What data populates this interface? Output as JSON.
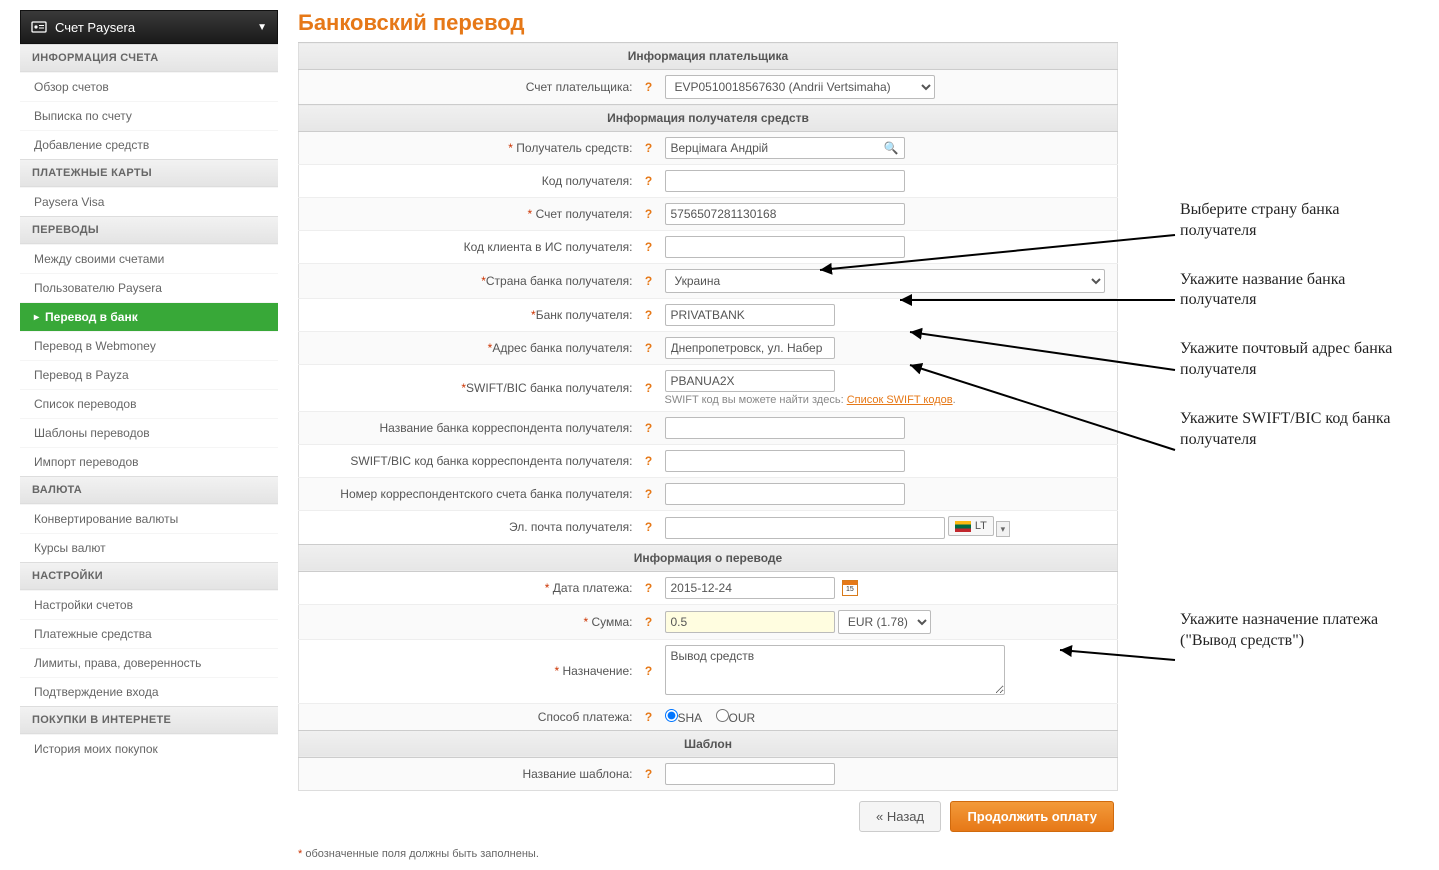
{
  "sidebar": {
    "header": "Счет Paysera",
    "sections": [
      {
        "title": "ИНФОРМАЦИЯ СЧЕТА",
        "items": [
          "Обзор счетов",
          "Выписка по счету",
          "Добавление средств"
        ]
      },
      {
        "title": "ПЛАТЕЖНЫЕ КАРТЫ",
        "items": [
          "Paysera Visa"
        ]
      },
      {
        "title": "ПЕРЕВОДЫ",
        "items": [
          "Между своими счетами",
          "Пользователю Paysera",
          "Перевод в банк",
          "Перевод в Webmoney",
          "Перевод в Payza",
          "Список переводов",
          "Шаблоны переводов",
          "Импорт переводов"
        ],
        "active_index": 2
      },
      {
        "title": "ВАЛЮТА",
        "items": [
          "Конвертирование валюты",
          "Курсы валют"
        ]
      },
      {
        "title": "НАСТРОЙКИ",
        "items": [
          "Настройки счетов",
          "Платежные средства",
          "Лимиты, права, доверенность",
          "Подтверждение входа"
        ]
      },
      {
        "title": "ПОКУПКИ В ИНТЕРНЕТЕ",
        "items": [
          "История моих покупок"
        ]
      }
    ]
  },
  "page_title": "Банковский перевод",
  "sections": {
    "payer": "Информация плательщика",
    "bene": "Информация получателя средств",
    "transfer": "Информация о переводе",
    "tpl": "Шаблон"
  },
  "fields": {
    "payer_account": {
      "label": "Счет плательщика:",
      "value": "EVP0510018567630 (Andrii Vertsimaha)"
    },
    "bene_name": {
      "label": "Получатель средств:",
      "required": true,
      "value": "Верцімага Андрій"
    },
    "bene_code": {
      "label": "Код получателя:",
      "value": ""
    },
    "bene_account": {
      "label": "Счет получателя:",
      "required": true,
      "value": "5756507281130168"
    },
    "bene_is_code": {
      "label": "Код клиента в ИС получателя:",
      "value": ""
    },
    "bank_country": {
      "label": "Страна банка получателя:",
      "required": true,
      "value": "Украина"
    },
    "bank_name": {
      "label": "Банк получателя:",
      "required": true,
      "value": "PRIVATBANK"
    },
    "bank_addr": {
      "label": "Адрес банка получателя:",
      "required": true,
      "value": "Днепропетровск, ул. Набер"
    },
    "swift": {
      "label": "SWIFT/BIC банка получателя:",
      "required": true,
      "value": "PBANUA2X",
      "hint_prefix": "SWIFT код вы можете найти здесь: ",
      "hint_link": "Список SWIFT кодов",
      "hint_suffix": "."
    },
    "corr_bank_name": {
      "label": "Название банка корреспондента получателя:",
      "value": ""
    },
    "corr_swift": {
      "label": "SWIFT/BIC код банка корреспондента получателя:",
      "value": ""
    },
    "corr_acct": {
      "label": "Номер корреспондентского счета банка получателя:",
      "value": ""
    },
    "bene_email": {
      "label": "Эл. почта получателя:",
      "value": "",
      "flag_label": "LT"
    },
    "pay_date": {
      "label": "Дата платежа:",
      "required": true,
      "value": "2015-12-24"
    },
    "amount": {
      "label": "Сумма:",
      "required": true,
      "value": "0.5",
      "currency": "EUR (1.78)"
    },
    "purpose": {
      "label": "Назначение:",
      "required": true,
      "value": "Вывод средств"
    },
    "pay_method": {
      "label": "Способ платежа:",
      "opt1": "SHA",
      "opt2": "OUR"
    },
    "tpl_name": {
      "label": "Название шаблона:",
      "value": ""
    }
  },
  "buttons": {
    "back": "« Назад",
    "continue": "Продолжить оплату"
  },
  "footnote_prefix": "* ",
  "footnote": "обозначенные поля должны быть заполнены.",
  "annotations": [
    "Выберите страну банка получателя",
    "Укажите название банка получателя",
    "Укажите почтовый адрес банка получателя",
    "Укажите SWIFT/BIC код банка получателя",
    "Укажите назначение платежа (\"Вывод средств\")"
  ]
}
